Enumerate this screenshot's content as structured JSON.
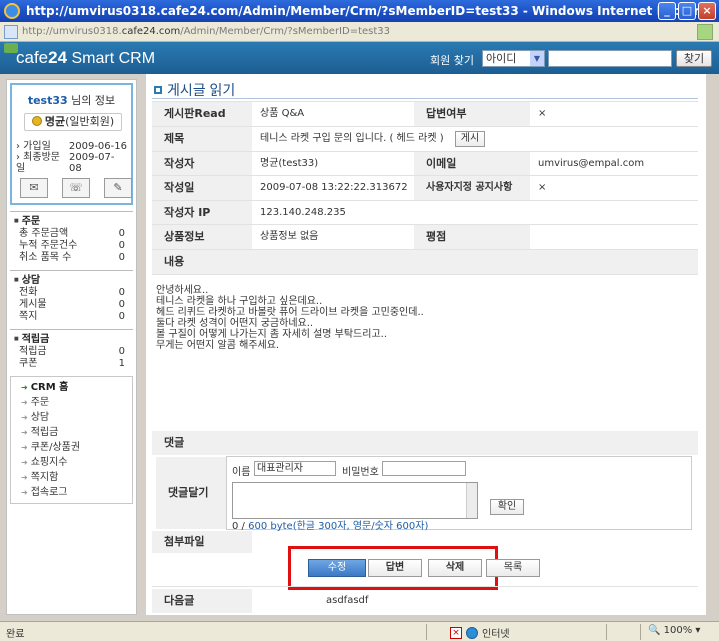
{
  "window": {
    "title": "http://umvirus0318.cafe24.com/Admin/Member/Crm/?sMemberID=test33 - Windows Internet Explorer",
    "address_pre": "http://umvirus0318.",
    "address_host": "cafe24.com",
    "address_post": "/Admin/Member/Crm/?sMemberID=test33"
  },
  "header": {
    "brand_cafe": "cafe",
    "brand_24": "24",
    "brand_suffix": " Smart CRM",
    "find_label": "회원 찾기",
    "find_select": "아이디",
    "find_button": "찾기"
  },
  "user": {
    "id": "test33",
    "info_suffix": " 님의 정보",
    "grade_name": "명균",
    "grade_type": "(일반회원)",
    "join_label": "› 가입일",
    "join_date": "2009-06-16",
    "last_label": "› 최종방문일",
    "last_date": "2009-07-08"
  },
  "side_sections": [
    {
      "title": "주문",
      "rows": [
        {
          "label": "총 주문금액",
          "value": "0"
        },
        {
          "label": "누적 주문건수",
          "value": "0"
        },
        {
          "label": "취소 품목 수",
          "value": "0"
        }
      ]
    },
    {
      "title": "상담",
      "rows": [
        {
          "label": "전화",
          "value": "0"
        },
        {
          "label": "게시물",
          "value": "0"
        },
        {
          "label": "쪽지",
          "value": "0"
        }
      ]
    },
    {
      "title": "적립금",
      "rows": [
        {
          "label": "적립금",
          "value": "0"
        },
        {
          "label": "쿠폰",
          "value": "1"
        }
      ]
    }
  ],
  "nav": {
    "items": [
      "CRM 홈",
      "주문",
      "상담",
      "적립금",
      "쿠폰/상품권",
      "쇼핑지수",
      "쪽지함",
      "접속로그"
    ]
  },
  "post": {
    "page_title": "게시글 읽기",
    "board_label": "게시판Read",
    "board_value": "상품 Q&A",
    "reply_label": "답변여부",
    "reply_value": "×",
    "subject_label": "제목",
    "subject_value": "테니스 라켓 구입 문의 입니다. ( 헤드 라켓 )",
    "subject_button": "게시",
    "author_label": "작성자",
    "author_value": "명균(test33)",
    "email_label": "이메일",
    "email_value": "umvirus@empal.com",
    "date_label": "작성일",
    "date_value": "2009-07-08 13:22:22.313672",
    "notice_label": "사용자지정 공지사항",
    "notice_value": "×",
    "ip_label": "작성자 IP",
    "ip_value": "123.140.248.235",
    "product_label": "상품정보",
    "product_value": "상품정보 없음",
    "rating_label": "평점",
    "content_label": "내용",
    "content_text": "안녕하세요..\n테니스 라켓을 하나 구입하고 싶은데요..\n헤드 리퀴드 라켓하고 바볼랏 퓨어 드라이브 라켓을 고민중인데..\n둘다 라켓 성격이 어떤지 궁금하네요..\n볼 구질이 어떻게 나가는지 좀 자세히 설명 부탁드리고..\n무게는 어떤지 알콤 해주세요."
  },
  "comment": {
    "section_label": "댓글",
    "add_label": "댓글달기",
    "name_label": "이름",
    "name_value": "대표관리자",
    "pw_label": "비밀번호",
    "confirm_button": "확인",
    "counter_prefix": "0 / ",
    "counter_limit": "600 byte(한글 300자, 영문/숫자 600자)",
    "attach_label": "첨부파일"
  },
  "actions": {
    "edit": "수정",
    "reply": "답변",
    "delete": "삭제",
    "list": "목록"
  },
  "next": {
    "label": "다음글",
    "value": "asdfasdf"
  },
  "status": {
    "left": "완료",
    "zone": "인터넷",
    "zoom": "100%"
  }
}
